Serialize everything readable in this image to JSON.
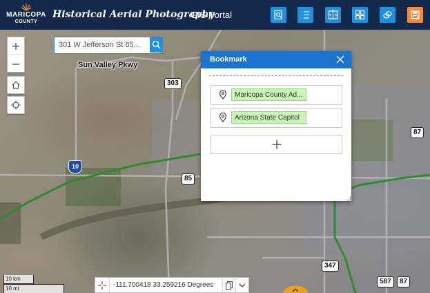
{
  "header": {
    "logo_line1": "MARICOPA",
    "logo_line2": "COUNTY",
    "app_title": "Historical Aerial Photography",
    "portal_link": "GIS Portal",
    "toolbar_icons": [
      "map-search-icon",
      "list-icon",
      "compare-icon",
      "grid-icon",
      "layers-icon",
      "save-icon"
    ]
  },
  "search": {
    "value": "301 W Jefferson St 85..."
  },
  "map_labels": {
    "road_name": "Sun Valley Pkwy",
    "route_303": "303",
    "route_87a": "87",
    "route_87b": "87",
    "route_85": "85",
    "interstate_10": "10",
    "route_347": "347",
    "route_587": "587",
    "route_87c": "87"
  },
  "bookmark_panel": {
    "title": "Bookmark",
    "items": [
      {
        "label": "Maricopa County Ad..."
      },
      {
        "label": "Arizona State Capitol"
      }
    ],
    "add_label": "+"
  },
  "scale": {
    "metric": "10 km",
    "imperial": "10 mi"
  },
  "coordinates": {
    "text": "-111.700418 33.259216 Degrees"
  },
  "colors": {
    "header_bg": "#13284a",
    "tool_blue": "#1f8fe0",
    "tool_orange": "#f08a3c",
    "panel_header": "#1973cf",
    "bookmark_highlight": "#c9f5b5"
  }
}
